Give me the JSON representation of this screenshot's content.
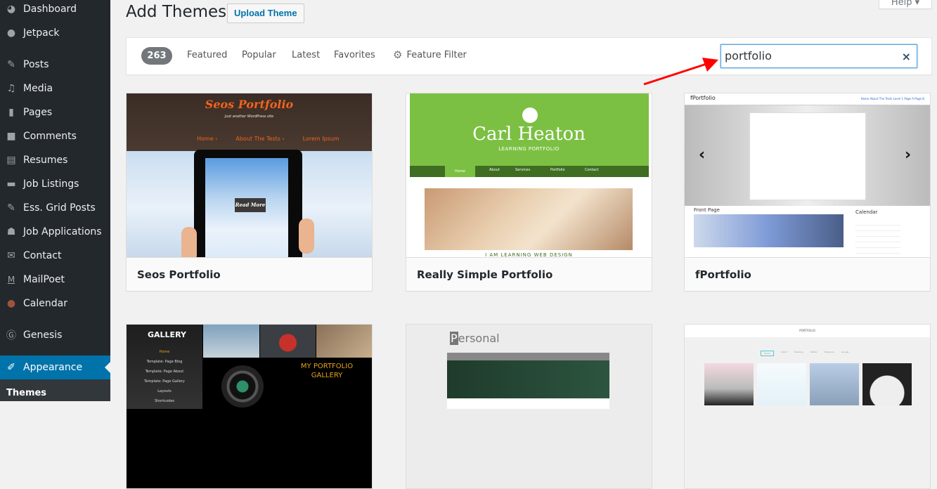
{
  "sidebar": {
    "items": [
      {
        "label": "Dashboard",
        "icon": "dashboard-icon"
      },
      {
        "label": "Jetpack",
        "icon": "jetpack-icon"
      },
      {
        "label": "Posts",
        "icon": "pin-icon"
      },
      {
        "label": "Media",
        "icon": "media-icon"
      },
      {
        "label": "Pages",
        "icon": "pages-icon"
      },
      {
        "label": "Comments",
        "icon": "comment-icon"
      },
      {
        "label": "Resumes",
        "icon": "document-icon"
      },
      {
        "label": "Job Listings",
        "icon": "briefcase-icon"
      },
      {
        "label": "Ess. Grid Posts",
        "icon": "pin-icon"
      },
      {
        "label": "Job Applications",
        "icon": "groups-icon"
      },
      {
        "label": "Contact",
        "icon": "envelope-icon"
      },
      {
        "label": "MailPoet",
        "icon": "mailpoet-icon"
      },
      {
        "label": "Calendar",
        "icon": "calendar-icon"
      },
      {
        "label": "Genesis",
        "icon": "genesis-icon"
      },
      {
        "label": "Appearance",
        "icon": "paintbrush-icon",
        "active": true
      }
    ],
    "submenu": {
      "label": "Themes"
    }
  },
  "header": {
    "title": "Add Themes",
    "upload_label": "Upload Theme",
    "help_label": "Help ▾"
  },
  "filter": {
    "count": "263",
    "links": [
      "Featured",
      "Popular",
      "Latest",
      "Favorites"
    ],
    "feature_filter": "Feature Filter",
    "search_value": "portfolio",
    "clear_icon": "×"
  },
  "themes": [
    {
      "name": "Seos Portfolio",
      "preview": {
        "brand": "Seos Portfolio",
        "tagline": "Just another WordPress site",
        "nav": [
          "Home ›",
          "About The Tests ›",
          "Lorem Ipsum"
        ],
        "button": "Read More"
      }
    },
    {
      "name": "Really Simple Portfolio",
      "preview": {
        "brand": "Carl Heaton",
        "sub": "LEARNING PORTFOLIO",
        "nav": [
          "Home",
          "About",
          "Services",
          "Portfolio",
          "Contact"
        ],
        "footer": "I AM LEARNING WEB DESIGN"
      }
    },
    {
      "name": "fPortfolio",
      "preview": {
        "brand": "fPortfolio",
        "menu": "Home  About The Tests  Level 1  Page A  Page B",
        "section": "Front Page",
        "widget": "Calendar"
      }
    },
    {
      "name": "",
      "preview": {
        "brand": "GALLERY",
        "menu": [
          "Home",
          "Template: Page Blog",
          "Template: Page About",
          "Template: Page Gallery",
          "Layouts",
          "Shortcodes"
        ],
        "headline": "MY PORTFOLIO GALLERY"
      }
    },
    {
      "name": "",
      "preview": {
        "brand_initial": "P",
        "brand_rest": "ersonal"
      }
    },
    {
      "name": "",
      "preview": {
        "brand": "PORTFOLIO",
        "tabs": [
          "Home",
          "About",
          "Features",
          "Twitter",
          "Facebook",
          "Google"
        ]
      }
    }
  ],
  "colors": {
    "accent": "#0073aa",
    "sidebar": "#23282d",
    "arrow": "#ff0000"
  }
}
